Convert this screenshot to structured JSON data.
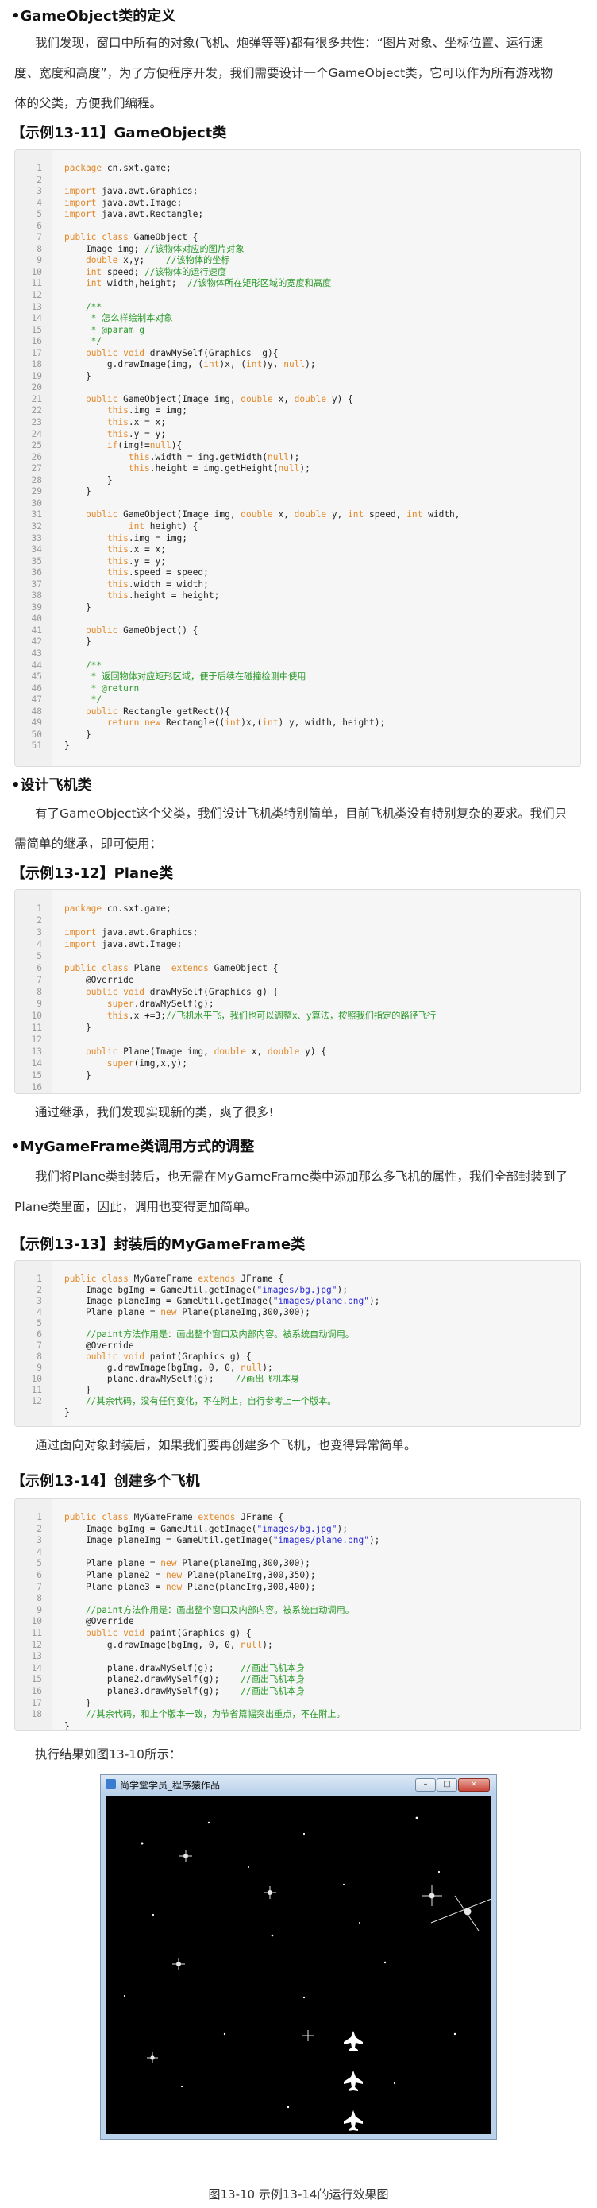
{
  "sections": {
    "s1_heading": "•GameObject类的定义",
    "s1_para": [
      "我们发现，窗口中所有的对象(飞机、炮弹等等)都有很多共性：“图片对象、坐标位置、运行速",
      "度、宽度和高度”，为了方便程序开发，我们需要设计一个GameObject类，它可以作为所有游戏物",
      "体的父类，方便我们编程。"
    ],
    "ex1_title": "【示例13-11】GameObject类",
    "s2_heading": "•设计飞机类",
    "s2_para": [
      "有了GameObject这个父类，我们设计飞机类特别简单，目前飞机类没有特别复杂的要求。我们只",
      "需简单的继承，即可使用："
    ],
    "ex2_title": "【示例13-12】Plane类",
    "s2_after": "通过继承，我们发现实现新的类，爽了很多!",
    "s3_heading": "•MyGameFrame类调用方式的调整",
    "s3_para": [
      "我们将Plane类封装后，也无需在MyGameFrame类中添加那么多飞机的属性，我们全部封装到了",
      "Plane类里面，因此，调用也变得更加简单。"
    ],
    "ex3_title": "【示例13-13】封装后的MyGameFrame类",
    "s3_after": "通过面向对象封装后，如果我们要再创建多个飞机，也变得异常简单。",
    "ex4_title": "【示例13-14】创建多个飞机",
    "s4_after": "执行结果如图13-10所示：",
    "figure_caption": "图13-10 示例13-14的运行效果图"
  },
  "window": {
    "title": "尚学堂学员_程序猿作品",
    "minimize": "–",
    "maximize": "□",
    "close": "×"
  },
  "colors": {
    "keyword": "#e2892a",
    "comment": "#2b9a2b",
    "string": "#2a2ad0",
    "line_number": "#9a9a9a"
  },
  "code1": [
    {
      "n": "1",
      "t": [
        [
          "kw",
          "package"
        ],
        [
          "p",
          " cn.sxt.game;"
        ]
      ]
    },
    {
      "n": "2",
      "t": []
    },
    {
      "n": "3",
      "t": [
        [
          "kw",
          "import"
        ],
        [
          "p",
          " java.awt.Graphics;"
        ]
      ]
    },
    {
      "n": "4",
      "t": [
        [
          "kw",
          "import"
        ],
        [
          "p",
          " java.awt.Image;"
        ]
      ]
    },
    {
      "n": "5",
      "t": [
        [
          "kw",
          "import"
        ],
        [
          "p",
          " java.awt.Rectangle;"
        ]
      ]
    },
    {
      "n": "6",
      "t": []
    },
    {
      "n": "7",
      "t": [
        [
          "kw",
          "public class"
        ],
        [
          "p",
          " GameObject {"
        ]
      ]
    },
    {
      "n": "8",
      "t": [
        [
          "p",
          "    Image img; "
        ],
        [
          "cm",
          "//该物体对应的图片对象"
        ]
      ]
    },
    {
      "n": "9",
      "t": [
        [
          "p",
          "    "
        ],
        [
          "kw",
          "double"
        ],
        [
          "p",
          " x,y;    "
        ],
        [
          "cm",
          "//该物体的坐标"
        ]
      ]
    },
    {
      "n": "10",
      "t": [
        [
          "p",
          "    "
        ],
        [
          "kw",
          "int"
        ],
        [
          "p",
          " speed; "
        ],
        [
          "cm",
          "//该物体的运行速度"
        ]
      ]
    },
    {
      "n": "11",
      "t": [
        [
          "p",
          "    "
        ],
        [
          "kw",
          "int"
        ],
        [
          "p",
          " width,height;  "
        ],
        [
          "cm",
          "//该物体所在矩形区域的宽度和高度"
        ]
      ]
    },
    {
      "n": "12",
      "t": []
    },
    {
      "n": "13",
      "t": [
        [
          "cm",
          "    /**"
        ]
      ]
    },
    {
      "n": "14",
      "t": [
        [
          "cm",
          "     * 怎么样绘制本对象"
        ]
      ]
    },
    {
      "n": "15",
      "t": [
        [
          "cm",
          "     * @param g"
        ]
      ]
    },
    {
      "n": "16",
      "t": [
        [
          "cm",
          "     */"
        ]
      ]
    },
    {
      "n": "17",
      "t": [
        [
          "p",
          "    "
        ],
        [
          "kw",
          "public void"
        ],
        [
          "p",
          " drawMySelf(Graphics  g){"
        ]
      ]
    },
    {
      "n": "18",
      "t": [
        [
          "p",
          "        g.drawImage(img, ("
        ],
        [
          "kw",
          "int"
        ],
        [
          "p",
          ")x, ("
        ],
        [
          "kw",
          "int"
        ],
        [
          "p",
          ")y, "
        ],
        [
          "kw",
          "null"
        ],
        [
          "p",
          ");"
        ]
      ]
    },
    {
      "n": "19",
      "t": [
        [
          "p",
          "    }"
        ]
      ]
    },
    {
      "n": "20",
      "t": []
    },
    {
      "n": "21",
      "t": [
        [
          "p",
          "    "
        ],
        [
          "kw",
          "public"
        ],
        [
          "p",
          " GameObject(Image img, "
        ],
        [
          "kw",
          "double"
        ],
        [
          "p",
          " x, "
        ],
        [
          "kw",
          "double"
        ],
        [
          "p",
          " y) {"
        ]
      ]
    },
    {
      "n": "22",
      "t": [
        [
          "p",
          "        "
        ],
        [
          "kw",
          "this"
        ],
        [
          "p",
          ".img = img;"
        ]
      ]
    },
    {
      "n": "23",
      "t": [
        [
          "p",
          "        "
        ],
        [
          "kw",
          "this"
        ],
        [
          "p",
          ".x = x;"
        ]
      ]
    },
    {
      "n": "24",
      "t": [
        [
          "p",
          "        "
        ],
        [
          "kw",
          "this"
        ],
        [
          "p",
          ".y = y;"
        ]
      ]
    },
    {
      "n": "25",
      "t": [
        [
          "p",
          "        "
        ],
        [
          "kw",
          "if"
        ],
        [
          "p",
          "(img!="
        ],
        [
          "kw",
          "null"
        ],
        [
          "p",
          "){"
        ]
      ]
    },
    {
      "n": "26",
      "t": [
        [
          "p",
          "            "
        ],
        [
          "kw",
          "this"
        ],
        [
          "p",
          ".width = img.getWidth("
        ],
        [
          "kw",
          "null"
        ],
        [
          "p",
          ");"
        ]
      ]
    },
    {
      "n": "27",
      "t": [
        [
          "p",
          "            "
        ],
        [
          "kw",
          "this"
        ],
        [
          "p",
          ".height = img.getHeight("
        ],
        [
          "kw",
          "null"
        ],
        [
          "p",
          ");"
        ]
      ]
    },
    {
      "n": "28",
      "t": [
        [
          "p",
          "        }"
        ]
      ]
    },
    {
      "n": "29",
      "t": [
        [
          "p",
          "    }"
        ]
      ]
    },
    {
      "n": "30",
      "t": []
    },
    {
      "n": "31",
      "t": [
        [
          "p",
          "    "
        ],
        [
          "kw",
          "public"
        ],
        [
          "p",
          " GameObject(Image img, "
        ],
        [
          "kw",
          "double"
        ],
        [
          "p",
          " x, "
        ],
        [
          "kw",
          "double"
        ],
        [
          "p",
          " y, "
        ],
        [
          "kw",
          "int"
        ],
        [
          "p",
          " speed, "
        ],
        [
          "kw",
          "int"
        ],
        [
          "p",
          " width,"
        ]
      ]
    },
    {
      "n": "32",
      "t": [
        [
          "p",
          "            "
        ],
        [
          "kw",
          "int"
        ],
        [
          "p",
          " height) {"
        ]
      ]
    },
    {
      "n": "33",
      "t": [
        [
          "p",
          "        "
        ],
        [
          "kw",
          "this"
        ],
        [
          "p",
          ".img = img;"
        ]
      ]
    },
    {
      "n": "34",
      "t": [
        [
          "p",
          "        "
        ],
        [
          "kw",
          "this"
        ],
        [
          "p",
          ".x = x;"
        ]
      ]
    },
    {
      "n": "35",
      "t": [
        [
          "p",
          "        "
        ],
        [
          "kw",
          "this"
        ],
        [
          "p",
          ".y = y;"
        ]
      ]
    },
    {
      "n": "36",
      "t": [
        [
          "p",
          "        "
        ],
        [
          "kw",
          "this"
        ],
        [
          "p",
          ".speed = speed;"
        ]
      ]
    },
    {
      "n": "37",
      "t": [
        [
          "p",
          "        "
        ],
        [
          "kw",
          "this"
        ],
        [
          "p",
          ".width = width;"
        ]
      ]
    },
    {
      "n": "38",
      "t": [
        [
          "p",
          "        "
        ],
        [
          "kw",
          "this"
        ],
        [
          "p",
          ".height = height;"
        ]
      ]
    },
    {
      "n": "39",
      "t": [
        [
          "p",
          "    }"
        ]
      ]
    },
    {
      "n": "40",
      "t": []
    },
    {
      "n": "41",
      "t": [
        [
          "p",
          "    "
        ],
        [
          "kw",
          "public"
        ],
        [
          "p",
          " GameObject() {"
        ]
      ]
    },
    {
      "n": "42",
      "t": [
        [
          "p",
          "    }"
        ]
      ]
    },
    {
      "n": "43",
      "t": []
    },
    {
      "n": "44",
      "t": [
        [
          "cm",
          "    /**"
        ]
      ]
    },
    {
      "n": "45",
      "t": [
        [
          "cm",
          "     * 返回物体对应矩形区域，便于后续在碰撞检测中使用"
        ]
      ]
    },
    {
      "n": "46",
      "t": [
        [
          "cm",
          "     * @return"
        ]
      ]
    },
    {
      "n": "47",
      "t": [
        [
          "cm",
          "     */"
        ]
      ]
    },
    {
      "n": "48",
      "t": [
        [
          "p",
          "    "
        ],
        [
          "kw",
          "public"
        ],
        [
          "p",
          " Rectangle getRect(){"
        ]
      ]
    },
    {
      "n": "49",
      "t": [
        [
          "p",
          "        "
        ],
        [
          "kw",
          "return new"
        ],
        [
          "p",
          " Rectangle(("
        ],
        [
          "kw",
          "int"
        ],
        [
          "p",
          ")x,("
        ],
        [
          "kw",
          "int"
        ],
        [
          "p",
          ") y, width, height);"
        ]
      ]
    },
    {
      "n": "50",
      "t": [
        [
          "p",
          "    }"
        ]
      ]
    },
    {
      "n": "51",
      "t": [
        [
          "p",
          "}"
        ]
      ]
    }
  ],
  "code2": [
    {
      "n": "1",
      "t": [
        [
          "kw",
          "package"
        ],
        [
          "p",
          " cn.sxt.game;"
        ]
      ]
    },
    {
      "n": "2",
      "t": []
    },
    {
      "n": "3",
      "t": [
        [
          "kw",
          "import"
        ],
        [
          "p",
          " java.awt.Graphics;"
        ]
      ]
    },
    {
      "n": "4",
      "t": [
        [
          "kw",
          "import"
        ],
        [
          "p",
          " java.awt.Image;"
        ]
      ]
    },
    {
      "n": "5",
      "t": []
    },
    {
      "n": "6",
      "t": [
        [
          "kw",
          "public class"
        ],
        [
          "p",
          " Plane  "
        ],
        [
          "kw",
          "extends"
        ],
        [
          "p",
          " GameObject {"
        ]
      ]
    },
    {
      "n": "7",
      "t": [
        [
          "p",
          "    @Override"
        ]
      ]
    },
    {
      "n": "8",
      "t": [
        [
          "p",
          "    "
        ],
        [
          "kw",
          "public void"
        ],
        [
          "p",
          " drawMySelf(Graphics g) {"
        ]
      ]
    },
    {
      "n": "9",
      "t": [
        [
          "p",
          "        "
        ],
        [
          "kw",
          "super"
        ],
        [
          "p",
          ".drawMySelf(g);"
        ]
      ]
    },
    {
      "n": "10",
      "t": [
        [
          "p",
          "        "
        ],
        [
          "kw",
          "this"
        ],
        [
          "p",
          ".x +=3;"
        ],
        [
          "cm",
          "//飞机水平飞，我们也可以调整x、y算法，按照我们指定的路径飞行"
        ]
      ]
    },
    {
      "n": "11",
      "t": [
        [
          "p",
          "    }"
        ]
      ]
    },
    {
      "n": "12",
      "t": []
    },
    {
      "n": "13",
      "t": [
        [
          "p",
          "    "
        ],
        [
          "kw",
          "public"
        ],
        [
          "p",
          " Plane(Image img, "
        ],
        [
          "kw",
          "double"
        ],
        [
          "p",
          " x, "
        ],
        [
          "kw",
          "double"
        ],
        [
          "p",
          " y) {"
        ]
      ]
    },
    {
      "n": "14",
      "t": [
        [
          "p",
          "        "
        ],
        [
          "kw",
          "super"
        ],
        [
          "p",
          "(img,x,y);"
        ]
      ]
    },
    {
      "n": "15",
      "t": [
        [
          "p",
          "    }"
        ]
      ]
    },
    {
      "n": "16",
      "t": []
    },
    {
      "n": "",
      "t": [
        [
          "p",
          "}"
        ]
      ]
    }
  ],
  "code3": [
    {
      "n": "1",
      "t": [
        [
          "kw",
          "public class"
        ],
        [
          "p",
          " MyGameFrame "
        ],
        [
          "kw",
          "extends"
        ],
        [
          "p",
          " JFrame {"
        ]
      ]
    },
    {
      "n": "2",
      "t": [
        [
          "p",
          "    Image bgImg = GameUtil.getImage("
        ],
        [
          "str",
          "\"images/bg.jpg\""
        ],
        [
          "p",
          ");"
        ]
      ]
    },
    {
      "n": "3",
      "t": [
        [
          "p",
          "    Image planeImg = GameUtil.getImage("
        ],
        [
          "str",
          "\"images/plane.png\""
        ],
        [
          "p",
          ");"
        ]
      ]
    },
    {
      "n": "4",
      "t": [
        [
          "p",
          "    Plane plane = "
        ],
        [
          "kw",
          "new"
        ],
        [
          "p",
          " Plane(planeImg,300,300);"
        ]
      ]
    },
    {
      "n": "5",
      "t": []
    },
    {
      "n": "6",
      "t": [
        [
          "cm",
          "    //paint方法作用是：画出整个窗口及内部内容。被系统自动调用。"
        ]
      ]
    },
    {
      "n": "7",
      "t": [
        [
          "p",
          "    @Override"
        ]
      ]
    },
    {
      "n": "8",
      "t": [
        [
          "p",
          "    "
        ],
        [
          "kw",
          "public void"
        ],
        [
          "p",
          " paint(Graphics g) {"
        ]
      ]
    },
    {
      "n": "9",
      "t": [
        [
          "p",
          "        g.drawImage(bgImg, 0, 0, "
        ],
        [
          "kw",
          "null"
        ],
        [
          "p",
          ");"
        ]
      ]
    },
    {
      "n": "10",
      "t": [
        [
          "p",
          "        plane.drawMySelf(g);    "
        ],
        [
          "cm",
          "//画出飞机本身"
        ]
      ]
    },
    {
      "n": "11",
      "t": [
        [
          "p",
          "    }"
        ]
      ]
    },
    {
      "n": "12",
      "t": [
        [
          "cm",
          "    //其余代码，没有任何变化，不在附上，自行参考上一个版本。"
        ]
      ]
    },
    {
      "n": "",
      "t": [
        [
          "p",
          "}"
        ]
      ]
    }
  ],
  "code4": [
    {
      "n": "1",
      "t": [
        [
          "kw",
          "public class"
        ],
        [
          "p",
          " MyGameFrame "
        ],
        [
          "kw",
          "extends"
        ],
        [
          "p",
          " JFrame {"
        ]
      ]
    },
    {
      "n": "2",
      "t": [
        [
          "p",
          "    Image bgImg = GameUtil.getImage("
        ],
        [
          "str",
          "\"images/bg.jpg\""
        ],
        [
          "p",
          ");"
        ]
      ]
    },
    {
      "n": "3",
      "t": [
        [
          "p",
          "    Image planeImg = GameUtil.getImage("
        ],
        [
          "str",
          "\"images/plane.png\""
        ],
        [
          "p",
          ");"
        ]
      ]
    },
    {
      "n": "4",
      "t": []
    },
    {
      "n": "5",
      "t": [
        [
          "p",
          "    Plane plane = "
        ],
        [
          "kw",
          "new"
        ],
        [
          "p",
          " Plane(planeImg,300,300);"
        ]
      ]
    },
    {
      "n": "6",
      "t": [
        [
          "p",
          "    Plane plane2 = "
        ],
        [
          "kw",
          "new"
        ],
        [
          "p",
          " Plane(planeImg,300,350);"
        ]
      ]
    },
    {
      "n": "7",
      "t": [
        [
          "p",
          "    Plane plane3 = "
        ],
        [
          "kw",
          "new"
        ],
        [
          "p",
          " Plane(planeImg,300,400);"
        ]
      ]
    },
    {
      "n": "8",
      "t": []
    },
    {
      "n": "9",
      "t": [
        [
          "cm",
          "    //paint方法作用是：画出整个窗口及内部内容。被系统自动调用。"
        ]
      ]
    },
    {
      "n": "10",
      "t": [
        [
          "p",
          "    @Override"
        ]
      ]
    },
    {
      "n": "11",
      "t": [
        [
          "p",
          "    "
        ],
        [
          "kw",
          "public void"
        ],
        [
          "p",
          " paint(Graphics g) {"
        ]
      ]
    },
    {
      "n": "12",
      "t": [
        [
          "p",
          "        g.drawImage(bgImg, 0, 0, "
        ],
        [
          "kw",
          "null"
        ],
        [
          "p",
          ");"
        ]
      ]
    },
    {
      "n": "13",
      "t": []
    },
    {
      "n": "14",
      "t": [
        [
          "p",
          "        plane.drawMySelf(g);     "
        ],
        [
          "cm",
          "//画出飞机本身"
        ]
      ]
    },
    {
      "n": "15",
      "t": [
        [
          "p",
          "        plane2.drawMySelf(g);    "
        ],
        [
          "cm",
          "//画出飞机本身"
        ]
      ]
    },
    {
      "n": "16",
      "t": [
        [
          "p",
          "        plane3.drawMySelf(g);    "
        ],
        [
          "cm",
          "//画出飞机本身"
        ]
      ]
    },
    {
      "n": "17",
      "t": [
        [
          "p",
          "    }"
        ]
      ]
    },
    {
      "n": "18",
      "t": [
        [
          "cm",
          "    //其余代码，和上个版本一致，为节省篇幅突出重点，不在附上。"
        ]
      ]
    },
    {
      "n": "",
      "t": [
        [
          "p",
          "}"
        ]
      ]
    }
  ]
}
